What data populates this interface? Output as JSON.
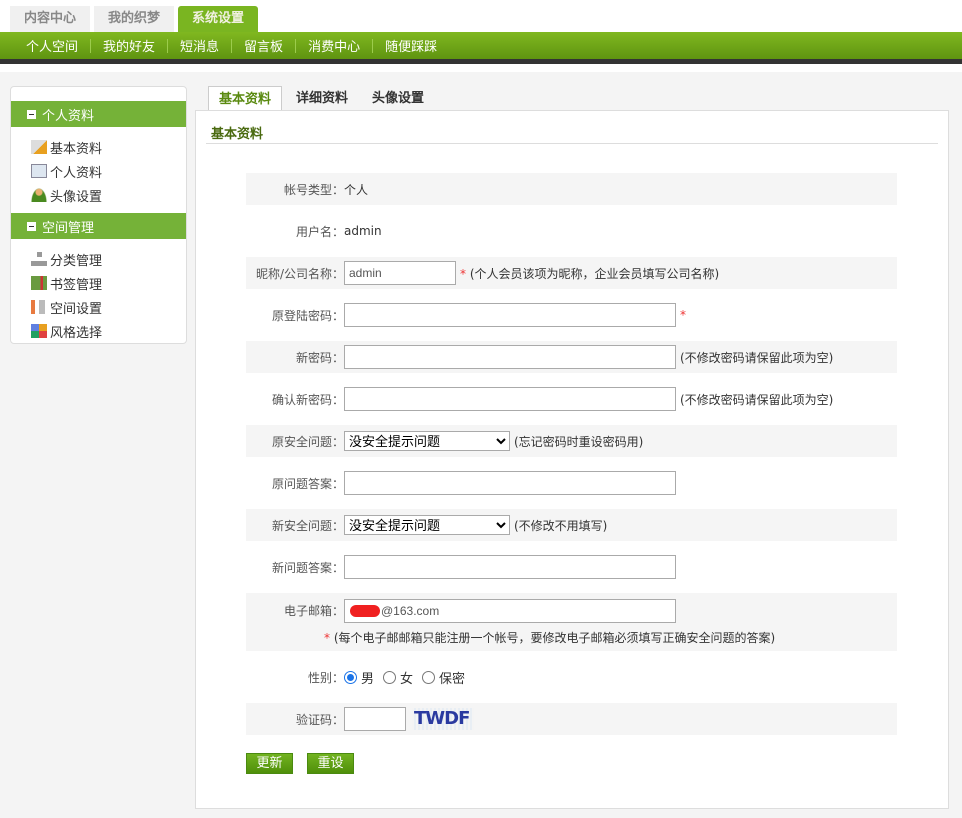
{
  "top_tabs": [
    "内容中心",
    "我的织梦",
    "系统设置"
  ],
  "nav": [
    "个人空间",
    "我的好友",
    "短消息",
    "留言板",
    "消费中心",
    "随便踩踩"
  ],
  "sidebar": {
    "groups": [
      {
        "title": "个人资料",
        "items": [
          "基本资料",
          "个人资料",
          "头像设置"
        ]
      },
      {
        "title": "空间管理",
        "items": [
          "分类管理",
          "书签管理",
          "空间设置",
          "风格选择"
        ]
      }
    ]
  },
  "main_tabs": [
    "基本资料",
    "详细资料",
    "头像设置"
  ],
  "section_title": "基本资料",
  "form": {
    "account_type_label": "帐号类型：",
    "account_type": "个人",
    "username_label": "用户名：",
    "username": "admin",
    "nickname_label": "昵称/公司名称：",
    "nickname": "admin",
    "nickname_note": "(个人会员该项为昵称，企业会员填写公司名称)",
    "old_pwd_label": "原登陆密码：",
    "new_pwd_label": "新密码：",
    "new_pwd_note": "(不修改密码请保留此项为空)",
    "confirm_pwd_label": "确认新密码：",
    "confirm_pwd_note": "(不修改密码请保留此项为空)",
    "old_q_label": "原安全问题：",
    "old_q_value": "没安全提示问题",
    "old_q_note": "(忘记密码时重设密码用)",
    "old_a_label": "原问题答案：",
    "new_q_label": "新安全问题：",
    "new_q_value": "没安全提示问题",
    "new_q_note": "(不修改不用填写)",
    "new_a_label": "新问题答案：",
    "email_label": "电子邮箱：",
    "email": "@163.com",
    "email_note": "(每个电子邮邮箱只能注册一个帐号，要修改电子邮箱必须填写正确安全问题的答案)",
    "gender_label": "性别：",
    "gender_options": [
      "男",
      "女",
      "保密"
    ],
    "gender_selected": "男",
    "captcha_label": "验证码：",
    "captcha_text": "TWDF",
    "star": "*"
  },
  "buttons": {
    "update": "更新",
    "reset": "重设"
  }
}
